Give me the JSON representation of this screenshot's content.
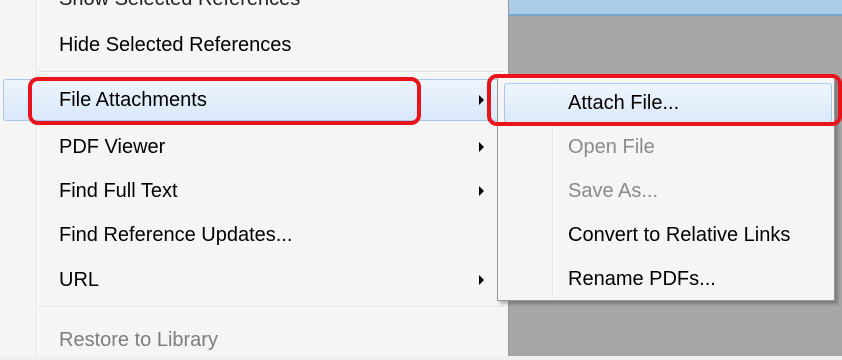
{
  "colors": {
    "annotation": "#e8131b",
    "highlight": "#d9e8f9",
    "disabled_text": "#7d7d7d"
  },
  "main_menu": {
    "cutoff_item": "Show Selected References",
    "items": [
      {
        "label": "Hide Selected References",
        "has_submenu": false,
        "enabled": true
      },
      {
        "label": "File Attachments",
        "has_submenu": true,
        "enabled": true,
        "highlighted": true
      },
      {
        "label": "PDF Viewer",
        "has_submenu": true,
        "enabled": true
      },
      {
        "label": "Find Full Text",
        "has_submenu": true,
        "enabled": true
      },
      {
        "label": "Find Reference Updates...",
        "has_submenu": false,
        "enabled": true
      },
      {
        "label": "URL",
        "has_submenu": true,
        "enabled": true
      },
      {
        "label": "Restore to Library",
        "has_submenu": false,
        "enabled": false
      }
    ]
  },
  "sub_menu": {
    "items": [
      {
        "label": "Attach File...",
        "enabled": true,
        "highlighted": true
      },
      {
        "label": "Open File",
        "enabled": false
      },
      {
        "label": "Save As...",
        "enabled": false
      },
      {
        "label": "Convert to Relative Links",
        "enabled": true
      },
      {
        "label": "Rename PDFs...",
        "enabled": true
      }
    ]
  }
}
